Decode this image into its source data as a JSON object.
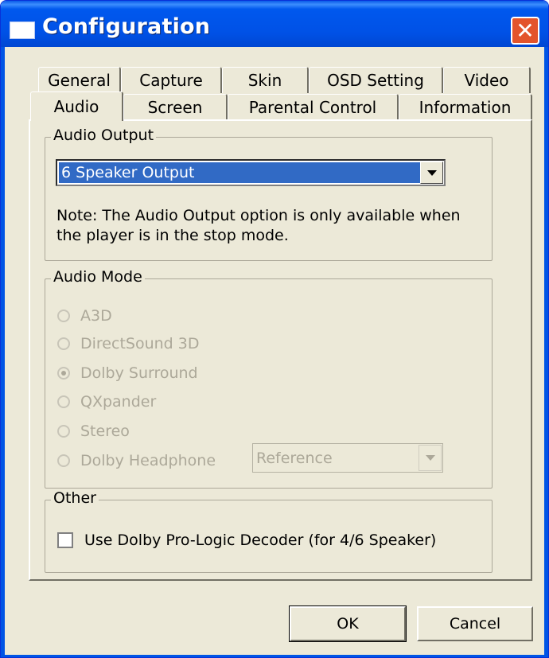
{
  "window": {
    "title": "Configuration",
    "close_glyph": "✕"
  },
  "tabs": {
    "row1": [
      "General",
      "Capture",
      "Skin",
      "OSD Setting",
      "Video"
    ],
    "row2": [
      "Audio",
      "Screen",
      "Parental Control",
      "Information"
    ],
    "active": "Audio"
  },
  "audio_output": {
    "group_label": "Audio Output",
    "selected": "6 Speaker Output",
    "note_line1": "Note:  The Audio Output option is only available when",
    "note_line2": "the player is in the stop mode."
  },
  "audio_mode": {
    "group_label": "Audio Mode",
    "options": [
      {
        "label": "A3D",
        "selected": false
      },
      {
        "label": "DirectSound 3D",
        "selected": false
      },
      {
        "label": "Dolby Surround",
        "selected": true
      },
      {
        "label": "QXpander",
        "selected": false
      },
      {
        "label": "Stereo",
        "selected": false
      },
      {
        "label": "Dolby Headphone",
        "selected": false
      }
    ],
    "headphone_mode": "Reference",
    "enabled": false
  },
  "other": {
    "group_label": "Other",
    "checkbox_label": "Use Dolby Pro-Logic Decoder (for 4/6 Speaker)",
    "checked": false
  },
  "buttons": {
    "ok": "OK",
    "cancel": "Cancel"
  }
}
